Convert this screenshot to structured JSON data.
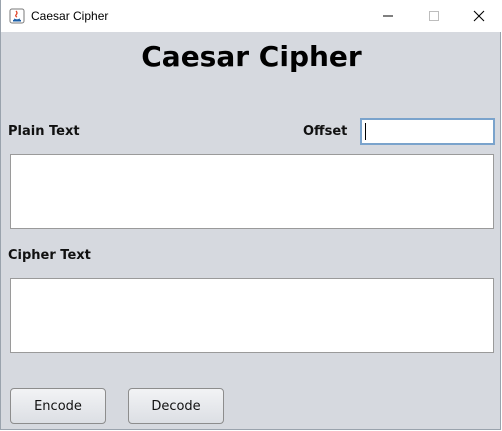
{
  "window": {
    "title": "Caesar Cipher",
    "icon": "java-app-icon"
  },
  "heading": "Caesar Cipher",
  "labels": {
    "plain_text": "Plain Text",
    "offset": "Offset",
    "cipher_text": "Cipher Text"
  },
  "fields": {
    "offset_value": "",
    "plain_text_value": "",
    "cipher_text_value": ""
  },
  "buttons": {
    "encode": "Encode",
    "decode": "Decode"
  },
  "window_controls": [
    "minimize-icon",
    "maximize-icon",
    "close-icon"
  ]
}
